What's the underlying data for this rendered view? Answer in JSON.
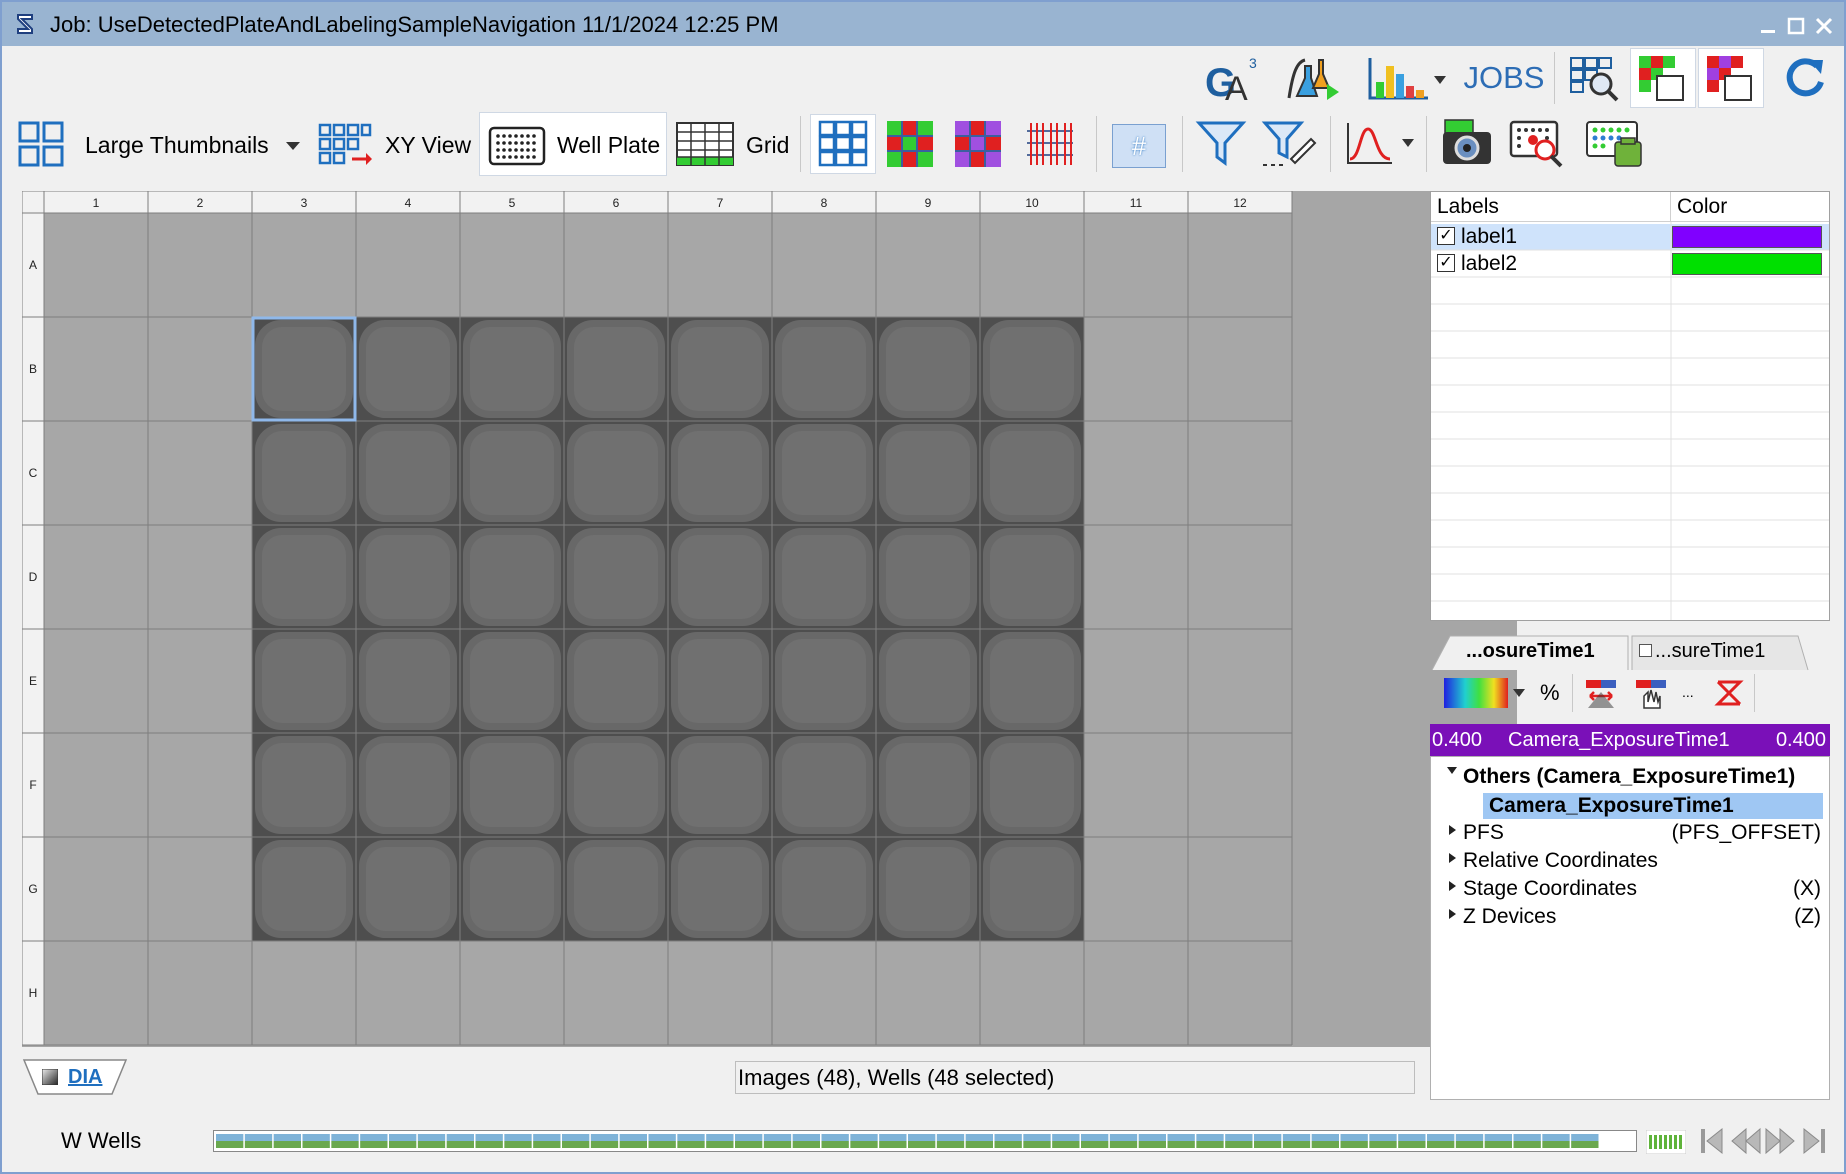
{
  "window": {
    "title": "Job: UseDetectedPlateAndLabelingSampleNavigation 11/1/2024 12:25 PM"
  },
  "toolbar_top": {
    "jobs_label": "JOBS"
  },
  "toolbar_view": {
    "thumbnail_mode": "Large Thumbnails",
    "xy_view_label": "XY View",
    "well_plate_label": "Well Plate",
    "grid_label": "Grid",
    "number_button_label": "#"
  },
  "plate": {
    "columns": [
      "1",
      "2",
      "3",
      "4",
      "5",
      "6",
      "7",
      "8",
      "9",
      "10",
      "11",
      "12"
    ],
    "rows": [
      "A",
      "B",
      "C",
      "D",
      "E",
      "F",
      "G",
      "H"
    ],
    "image_wells": {
      "B": [
        3,
        4,
        5,
        6,
        7,
        8,
        9,
        10
      ],
      "C": [
        3,
        4,
        5,
        6,
        7,
        8,
        9,
        10
      ],
      "D": [
        3,
        4,
        5,
        6,
        7,
        8,
        9,
        10
      ],
      "E": [
        3,
        4,
        5,
        6,
        7,
        8,
        9,
        10
      ],
      "F": [
        3,
        4,
        5,
        6,
        7,
        8,
        9,
        10
      ],
      "G": [
        3,
        4,
        5,
        6,
        7,
        8,
        9,
        10
      ]
    },
    "selected_well": "B3"
  },
  "labels_table": {
    "header_labels": "Labels",
    "header_color": "Color",
    "rows": [
      {
        "name": "label1",
        "checked": true,
        "color": "#8000ff",
        "selected": true
      },
      {
        "name": "label2",
        "checked": true,
        "color": "#00e000",
        "selected": false
      }
    ]
  },
  "feature_tabs": [
    {
      "label": "...osureTime1",
      "active": true
    },
    {
      "label": "...sureTime1",
      "active": false
    }
  ],
  "feature_tools": {
    "percent_label": "%",
    "more_label": "..."
  },
  "feature_bar": {
    "min": "0.400",
    "name": "Camera_ExposureTime1",
    "max": "0.400",
    "color": "#7a10b8"
  },
  "tree": {
    "others": "Others  (Camera_ExposureTime1)",
    "others_child": "Camera_ExposureTime1",
    "items": [
      {
        "name": "PFS",
        "value": "(PFS_OFFSET)"
      },
      {
        "name": "Relative Coordinates",
        "value": ""
      },
      {
        "name": "Stage Coordinates",
        "value": "(X)"
      },
      {
        "name": "Z Devices",
        "value": "(Z)"
      }
    ]
  },
  "channel_tab": "DIA",
  "status_text": "Images (48),  Wells (48 selected)",
  "bottom": {
    "wells_label": "W Wells"
  }
}
